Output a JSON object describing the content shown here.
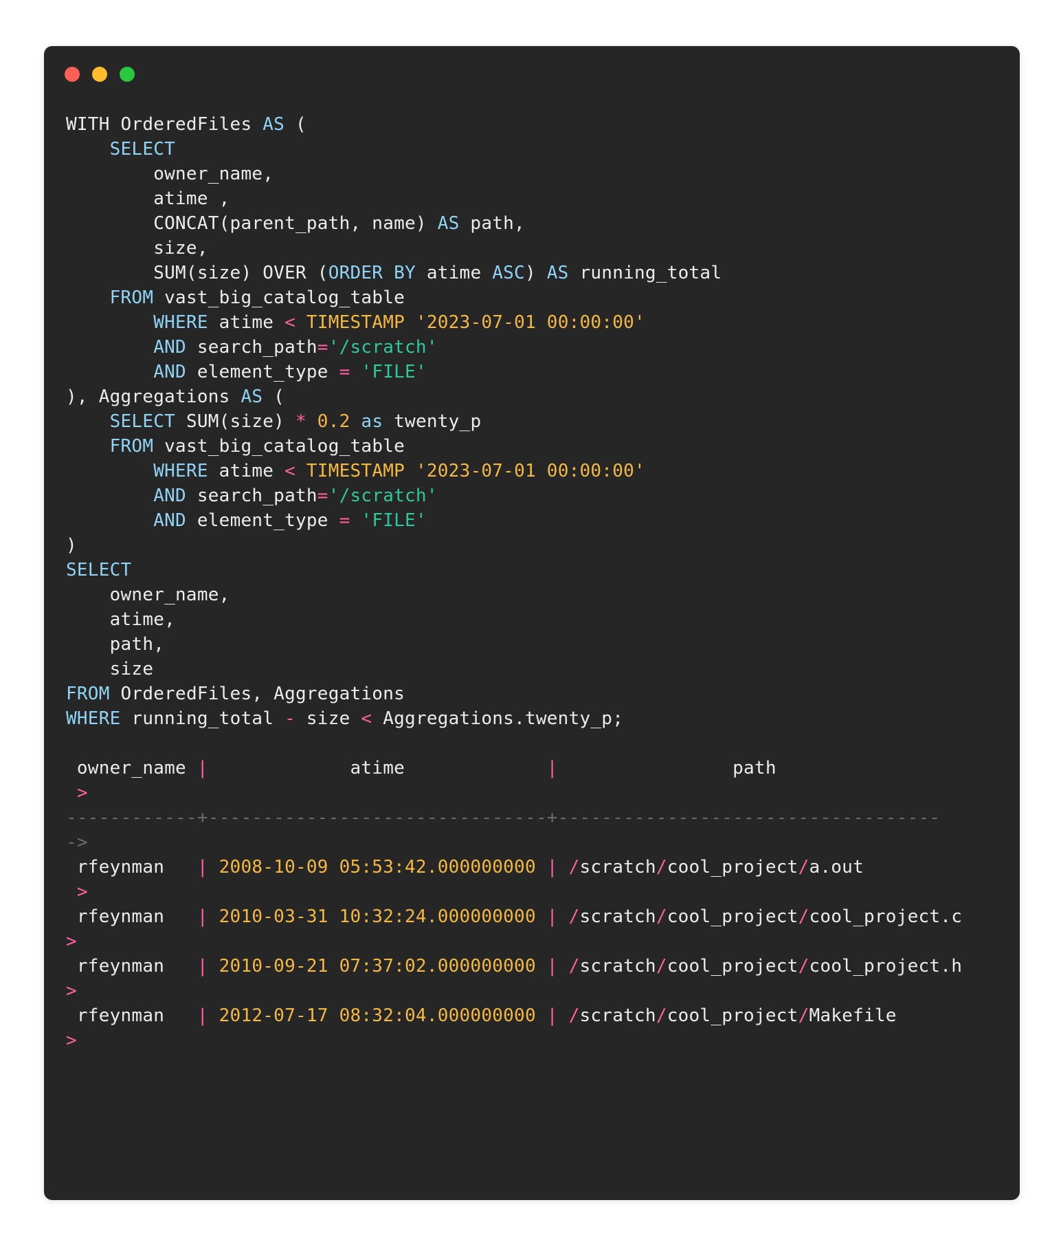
{
  "window": {
    "controls": [
      "close",
      "minimize",
      "zoom"
    ]
  },
  "code": {
    "l01": {
      "a": "WITH OrderedFiles ",
      "b": "AS",
      "c": " ("
    },
    "l02": {
      "ind": "    ",
      "a": "SELECT"
    },
    "l03": {
      "a": "        owner_name,"
    },
    "l04": {
      "a": "        atime ,"
    },
    "l05": {
      "a": "        CONCAT(parent_path, name) ",
      "b": "AS",
      "c": " path,"
    },
    "l06": {
      "a": "        size,"
    },
    "l07": {
      "a": "        SUM(size) OVER (",
      "b": "ORDER BY",
      "c": " atime ",
      "d": "ASC",
      "e": ") ",
      "f": "AS",
      "g": " running_total"
    },
    "l08": {
      "ind": "    ",
      "a": "FROM",
      "b": " vast_big_catalog_table"
    },
    "l09": {
      "ind": "        ",
      "a": "WHERE",
      "b": " atime ",
      "c": "<",
      "d": " ",
      "e": "TIMESTAMP",
      "f": " '2023-07-01 00:00:00'"
    },
    "l10": {
      "ind": "        ",
      "a": "AND",
      "b": " search_path",
      "c": "=",
      "d": "'/scratch'"
    },
    "l11": {
      "ind": "        ",
      "a": "AND",
      "b": " element_type ",
      "c": "=",
      "d": " ",
      "e": "'FILE'"
    },
    "l12": {
      "a": "), Aggregations ",
      "b": "AS",
      "c": " ("
    },
    "l13": {
      "ind": "    ",
      "a": "SELECT",
      "b": " SUM(size) ",
      "c": "*",
      "d": " ",
      "e": "0.2",
      "f": " ",
      "g": "as",
      "h": " twenty_p"
    },
    "l14": {
      "ind": "    ",
      "a": "FROM",
      "b": " vast_big_catalog_table"
    },
    "l15": {
      "ind": "        ",
      "a": "WHERE",
      "b": " atime ",
      "c": "<",
      "d": " ",
      "e": "TIMESTAMP",
      "f": " '2023-07-01 00:00:00'"
    },
    "l16": {
      "ind": "        ",
      "a": "AND",
      "b": " search_path",
      "c": "=",
      "d": "'/scratch'"
    },
    "l17": {
      "ind": "        ",
      "a": "AND",
      "b": " element_type ",
      "c": "=",
      "d": " ",
      "e": "'FILE'"
    },
    "l18": {
      "a": ")"
    },
    "l19": {
      "a": "SELECT"
    },
    "l20": {
      "a": "    owner_name,"
    },
    "l21": {
      "a": "    atime,"
    },
    "l22": {
      "a": "    path,"
    },
    "l23": {
      "a": "    size"
    },
    "l24": {
      "a": "FROM",
      "b": " OrderedFiles, Aggregations"
    },
    "l25": {
      "a": "WHERE",
      "b": " running_total ",
      "c": "-",
      "d": " size ",
      "e": "<",
      "f": " Aggregations.twenty_p;"
    }
  },
  "result": {
    "header": {
      "owner": " owner_name ",
      "sep1": "|",
      "atime": "             atime             ",
      "sep2": "|",
      "path": "                path"
    },
    "header_cont": " >",
    "divider": {
      "a": "------------",
      "plus1": "+",
      "b": "-------------------------------",
      "plus2": "+",
      "c": "-----------------------------------"
    },
    "divider_cont": "->",
    "rows": [
      {
        "owner": " rfeynman   ",
        "sep1": "|",
        "atime": " 2008-10-09 05:53:42.000000000 ",
        "sep2": "|",
        "s1": " /",
        "p1": "scratch",
        "s2": "/",
        "p2": "cool_project",
        "s3": "/",
        "p3": "a.out",
        "cont": " >"
      },
      {
        "owner": " rfeynman   ",
        "sep1": "|",
        "atime": " 2010-03-31 10:32:24.000000000 ",
        "sep2": "|",
        "s1": " /",
        "p1": "scratch",
        "s2": "/",
        "p2": "cool_project",
        "s3": "/",
        "p3": "cool_project.c",
        "cont": ">"
      },
      {
        "owner": " rfeynman   ",
        "sep1": "|",
        "atime": " 2010-09-21 07:37:02.000000000 ",
        "sep2": "|",
        "s1": " /",
        "p1": "scratch",
        "s2": "/",
        "p2": "cool_project",
        "s3": "/",
        "p3": "cool_project.h",
        "cont": ">"
      },
      {
        "owner": " rfeynman   ",
        "sep1": "|",
        "atime": " 2012-07-17 08:32:04.000000000 ",
        "sep2": "|",
        "s1": " /",
        "p1": "scratch",
        "s2": "/",
        "p2": "cool_project",
        "s3": "/",
        "p3": "Makefile",
        "cont": ">"
      }
    ]
  }
}
